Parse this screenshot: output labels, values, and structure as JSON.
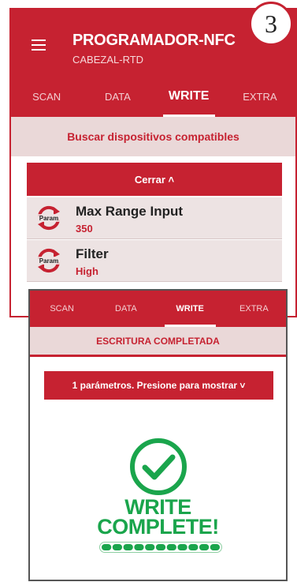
{
  "app": {
    "title": "PROGRAMADOR-NFC",
    "subtitle": "CABEZAL-RTD"
  },
  "step_number": "3",
  "tabs": [
    "SCAN",
    "DATA",
    "WRITE",
    "EXTRA"
  ],
  "active_tab": "WRITE",
  "screen1": {
    "scan_label": "Buscar dispositivos compatibles",
    "close_label": "Cerrar ˄",
    "params": [
      {
        "badge": "Param",
        "name": "Max Range Input",
        "value": "350"
      },
      {
        "badge": "Param",
        "name": "Filter",
        "value": "High"
      }
    ]
  },
  "screen2": {
    "status": "ESCRITURA COMPLETADA",
    "params_button": "1 parámetros. Presione para mostrar ˅",
    "complete_line1": "WRITE",
    "complete_line2": "COMPLETE!",
    "progress": 1.0
  },
  "colors": {
    "primary": "#c62231",
    "success": "#1aa54c",
    "light_bar": "#ead8d8"
  },
  "icons": [
    "menu-icon",
    "param-sync-icon",
    "check-circle-icon",
    "progress-bar"
  ]
}
